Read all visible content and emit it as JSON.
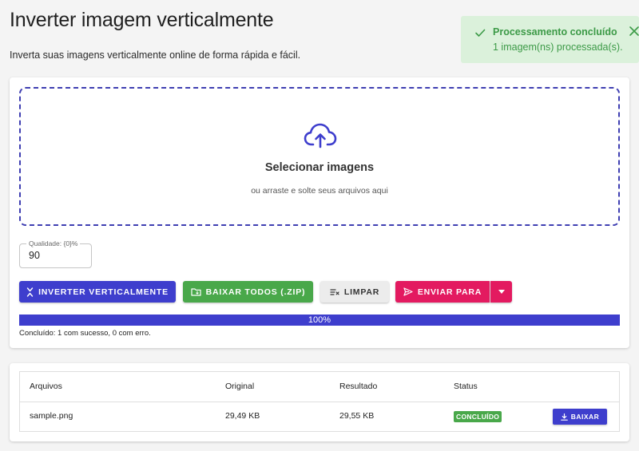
{
  "header": {
    "title": "Inverter imagem verticalmente",
    "subtitle": "Inverta suas imagens verticalmente online de forma rápida e fácil."
  },
  "toast": {
    "title": "Processamento concluído",
    "message": "1 imagem(ns) processada(s).",
    "icon": "check-icon",
    "close_icon": "close-icon",
    "color": "#3c9a47",
    "background": "#dbf1db"
  },
  "upload": {
    "icon": "cloud-upload-icon",
    "title": "Selecionar imagens",
    "subtitle": "ou arraste e solte seus arquivos aqui"
  },
  "quality": {
    "label": "Qualidade: {0}%",
    "value": "90"
  },
  "actions": {
    "invert_label": "INVERTER VERTICALMENTE",
    "zip_label": "BAIXAR TODOS (.ZIP)",
    "clear_label": "LIMPAR",
    "send_label": "ENVIAR PARA",
    "colors": {
      "primary": "#3e3ecd",
      "success": "#49a84a",
      "neutral": "#ececec",
      "send": "#e31a60"
    }
  },
  "progress": {
    "percent": 100,
    "label": "100%",
    "status": "Concluído: 1 com sucesso, 0 com erro."
  },
  "files_table": {
    "headers": [
      "Arquivos",
      "Original",
      "Resultado",
      "Status"
    ],
    "rows": [
      {
        "name": "sample.png",
        "original": "29,49 KB",
        "result": "29,55 KB",
        "status": "CONCLUÍDO",
        "action": "BAIXAR"
      }
    ]
  }
}
